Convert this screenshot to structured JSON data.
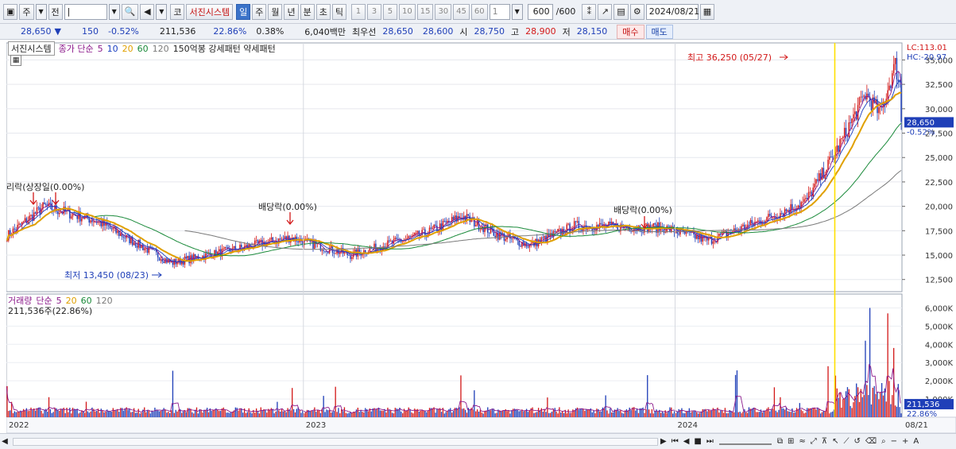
{
  "toolbar": {
    "btn_type": "주",
    "btn_prefix": "전",
    "code_value": "|",
    "stock_prefix": "코",
    "stock_name": "서진시스템",
    "periods": [
      "일",
      "주",
      "월",
      "년",
      "분",
      "초",
      "틱"
    ],
    "selected_period": "일",
    "intervals": [
      "1",
      "3",
      "5",
      "10",
      "15",
      "30",
      "45",
      "60"
    ],
    "count_value": "1",
    "display_count": "600",
    "total_count": "/600",
    "date_value": "2024/08/21"
  },
  "quote": {
    "price": "28,650",
    "change_dir": "▼",
    "change": "150",
    "change_pct": "-0.52%",
    "volume": "211,536",
    "volume_ratio": "22.86%",
    "turnover": "0.38%",
    "amount": "6,040백만",
    "best_label": "최우선",
    "best_ask": "28,650",
    "best_bid": "28,600",
    "open_label": "시",
    "open": "28,750",
    "high_label": "고",
    "high": "28,900",
    "low_label": "저",
    "low": "28,150",
    "buy_label": "매수",
    "sell_label": "매도"
  },
  "price_legend": {
    "name": "서진시스템",
    "ma_label": "종가 단순",
    "ma_periods": [
      "5",
      "10",
      "20",
      "60",
      "120"
    ],
    "extra": "150억봉 강세패턴  약세패턴",
    "lc": "LC:113.01",
    "hc": "HC:-20.97",
    "last_price": "28,650",
    "last_pct": "-0.52%"
  },
  "volume_legend": {
    "title": "거래량",
    "ma_label": "단순",
    "ma_periods": [
      "5",
      "20",
      "60",
      "120"
    ],
    "value": "211,536주(22.86%)",
    "last_volume": "211,536",
    "last_pct": "22.86%"
  },
  "annotations": {
    "high": "최고 36,250 (05/27)",
    "low": "최저 13,450 (08/23)",
    "left_overlap": "리락(상장일(0.00%)",
    "div1": "배당락(0.00%)",
    "div2": "배당락(0.00%)"
  },
  "x_labels": [
    "2022",
    "2023",
    "2024",
    "08/21"
  ],
  "price_ticks": [
    "35,000",
    "32,500",
    "30,000",
    "27,500",
    "25,000",
    "22,500",
    "20,000",
    "17,500",
    "15,000",
    "12,500"
  ],
  "volume_ticks": [
    "6,000K",
    "5,000K",
    "4,000K",
    "3,000K",
    "2,000K",
    "1,000K"
  ],
  "colors": {
    "up": "#d31919",
    "down": "#1f3fb8",
    "ma5": "#8b1a8b",
    "ma10": "#1a3ec0",
    "ma20": "#e0a000",
    "ma60": "#1a8a3a",
    "ma120": "#7a7a7a",
    "marker": "#ffe000"
  }
}
